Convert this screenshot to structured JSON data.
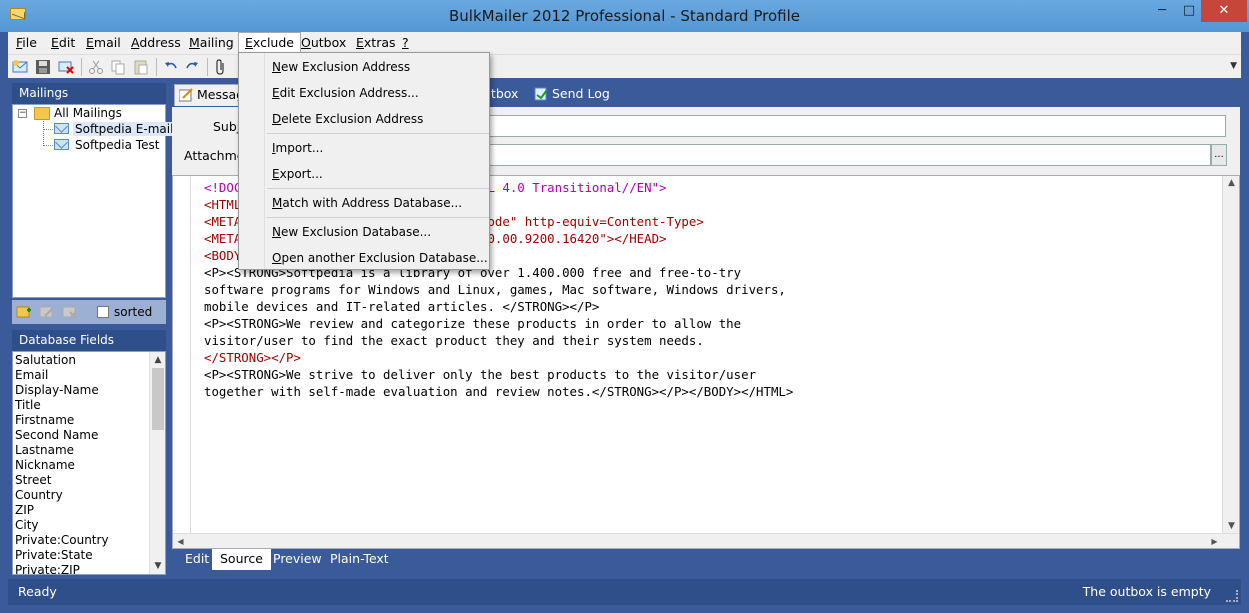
{
  "window": {
    "title": "BulkMailer 2012 Professional - Standard Profile",
    "minimize": "─",
    "maximize": "□",
    "close": "✕"
  },
  "menubar": [
    {
      "label": "File",
      "key": "F",
      "rest": "ile"
    },
    {
      "label": "Edit",
      "key": "E",
      "rest": "dit"
    },
    {
      "label": "Email",
      "key": "E",
      "rest": "mail"
    },
    {
      "label": "Address",
      "key": "A",
      "rest": "ddress"
    },
    {
      "label": "Mailing",
      "key": "M",
      "rest": "ailing"
    },
    {
      "label": "Exclude",
      "key": "E",
      "rest": "xclude"
    },
    {
      "label": "Outbox",
      "key": "O",
      "rest": "utbox"
    },
    {
      "label": "Extras",
      "key": "E",
      "rest": "xtras"
    },
    {
      "label": "?",
      "key": "?",
      "rest": ""
    }
  ],
  "exclude_menu": [
    {
      "key": "N",
      "rest": "ew Exclusion Address"
    },
    {
      "key": "E",
      "rest": "dit Exclusion Address..."
    },
    {
      "key": "D",
      "rest": "elete Exclusion Address"
    },
    {
      "key": "I",
      "rest": "mport..."
    },
    {
      "key": "E",
      "rest": "xport..."
    },
    {
      "key": "M",
      "rest": "atch with Address Database..."
    },
    {
      "key": "N",
      "rest": "ew Exclusion Database..."
    },
    {
      "key": "O",
      "rest": "pen another Exclusion Database..."
    }
  ],
  "mailings": {
    "header": "Mailings",
    "root": "All Mailings",
    "items": [
      "Softpedia E-mail",
      "Softpedia Test"
    ],
    "sorted_label": "sorted"
  },
  "database_fields": {
    "header": "Database Fields",
    "items": [
      "Salutation",
      "Email",
      "Display-Name",
      "Title",
      "Firstname",
      "Second Name",
      "Lastname",
      "Nickname",
      "Street",
      "Country",
      "ZIP",
      "City",
      "Private:Country",
      "Private:State",
      "Private:ZIP"
    ]
  },
  "tabs": {
    "message": "Messag",
    "outbox": "utbox",
    "sendlog": "Send Log"
  },
  "form": {
    "subject_label": "Subj",
    "attachments_label": "Attachme",
    "browse": "..."
  },
  "code_lines": [
    "<!DOCTYPE HTML PUBLIC \"-//W3C//DTD HTML 4.0 Transitional//EN\">",
    "<HTML><HEAD>",
    "<META content=\"text/html; charset=unicode\" http-equiv=Content-Type>",
    "<META name=GENERATOR content=\"MSHTML 10.00.9200.16420\"></HEAD>",
    "<BODY>",
    "<P><STRONG>Softpedia is a library of over 1.400.000 free and free-to-try",
    "software programs for Windows and Linux, games, Mac software, Windows drivers,",
    "mobile devices and IT-related articles. </STRONG></P>",
    "<P><STRONG>We review and categorize these products in order to allow the",
    "visitor/user to find the exact product they and their system needs.",
    "</STRONG></P>",
    "<P><STRONG>We strive to deliver only the best products to the visitor/user",
    "together with self-made evaluation and review notes.</STRONG></P></BODY></HTML>"
  ],
  "bottom_tabs": [
    "Edit",
    "Source",
    "Preview",
    "Plain-Text"
  ],
  "status": {
    "left": "Ready",
    "right": "The outbox is empty"
  },
  "colors": {
    "frame": "#3a5a9a",
    "panel_header": "#2f4f8a",
    "titlebar": "#5b9bd5",
    "close": "#c7463a"
  }
}
